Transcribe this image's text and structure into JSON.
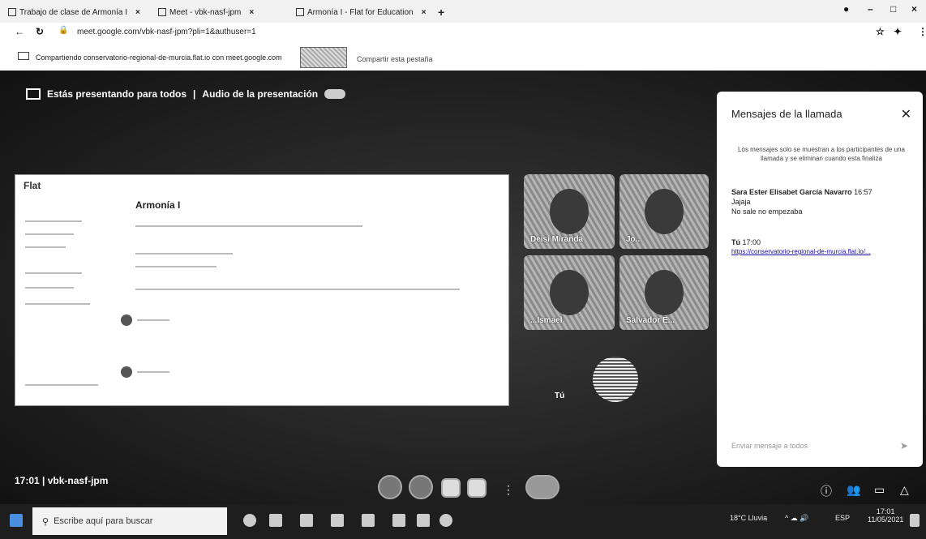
{
  "browser": {
    "tabs": [
      {
        "label": "Trabajo de clase de Armonía I"
      },
      {
        "label": "Meet - vbk-nasf-jpm"
      },
      {
        "label": "Armonía I - Flat for Education"
      }
    ],
    "new_tab": "+",
    "url": "meet.google.com/vbk-nasf-jpm?pli=1&authuser=1"
  },
  "share_bar": {
    "text": "Compartiendo conservatorio-regional-de-murcia.flat.io con meet.google.com",
    "share_tab": "Compartir esta pestaña"
  },
  "meet": {
    "presenting_text": "Estás presentando para todos",
    "presentation_audio": "Audio de la presentación",
    "meeting_time": "17:01",
    "meeting_code": "vbk-nasf-jpm"
  },
  "shared_window": {
    "logo": "Flat",
    "title": "Armonía I"
  },
  "participants": [
    {
      "name": "Deisi Miranda"
    },
    {
      "name": "Jo..."
    },
    {
      "name": "...Ismael"
    },
    {
      "name": "Salvador E..."
    }
  ],
  "you_tile": {
    "name": "Tú"
  },
  "chat": {
    "title": "Mensajes de la llamada",
    "note": "Los mensajes solo se muestran a los participantes de una llamada y se eliminan cuando esta finaliza",
    "messages": [
      {
        "sender": "Sara Ester Elisabet García Navarro",
        "time": "16:57",
        "lines": [
          "Jajaja",
          "No sale no empezaba"
        ]
      },
      {
        "sender": "Tú",
        "time": "17:00",
        "lines": [
          "https://conservatorio-regional-de-murcia.flat.io/..."
        ]
      }
    ],
    "input_placeholder": "Enviar mensaje a todos"
  },
  "taskbar": {
    "search_placeholder": "Escribe aquí para buscar",
    "weather": "18°C Lluvia",
    "lang": "ESP",
    "time": "17:01",
    "date": "11/05/2021"
  }
}
